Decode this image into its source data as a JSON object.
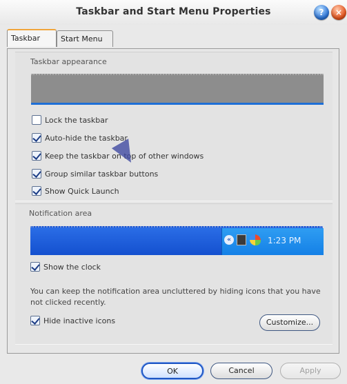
{
  "window": {
    "title": "Taskbar and Start Menu Properties"
  },
  "tabs": [
    {
      "label": "Taskbar",
      "selected": true
    },
    {
      "label": "Start Menu",
      "selected": false
    }
  ],
  "appearance": {
    "label": "Taskbar appearance",
    "options": [
      {
        "label": "Lock the taskbar",
        "checked": false
      },
      {
        "label": "Auto-hide the taskbar",
        "checked": true
      },
      {
        "label": "Keep the taskbar on top of other windows",
        "checked": true
      },
      {
        "label": "Group similar taskbar buttons",
        "checked": true
      },
      {
        "label": "Show Quick Launch",
        "checked": true
      }
    ]
  },
  "notification": {
    "label": "Notification area",
    "clock": "1:23 PM",
    "show_clock": {
      "label": "Show the clock",
      "checked": true
    },
    "info": "You can keep the notification area uncluttered by hiding icons that you have not clicked recently.",
    "hide_inactive": {
      "label": "Hide inactive icons",
      "checked": true
    },
    "customize_label": "Customize..."
  },
  "buttons": {
    "ok": "OK",
    "cancel": "Cancel",
    "apply": "Apply"
  },
  "colors": {
    "accent": "#1e6fd6",
    "tray": "#1480e6",
    "close": "#e6541d"
  }
}
